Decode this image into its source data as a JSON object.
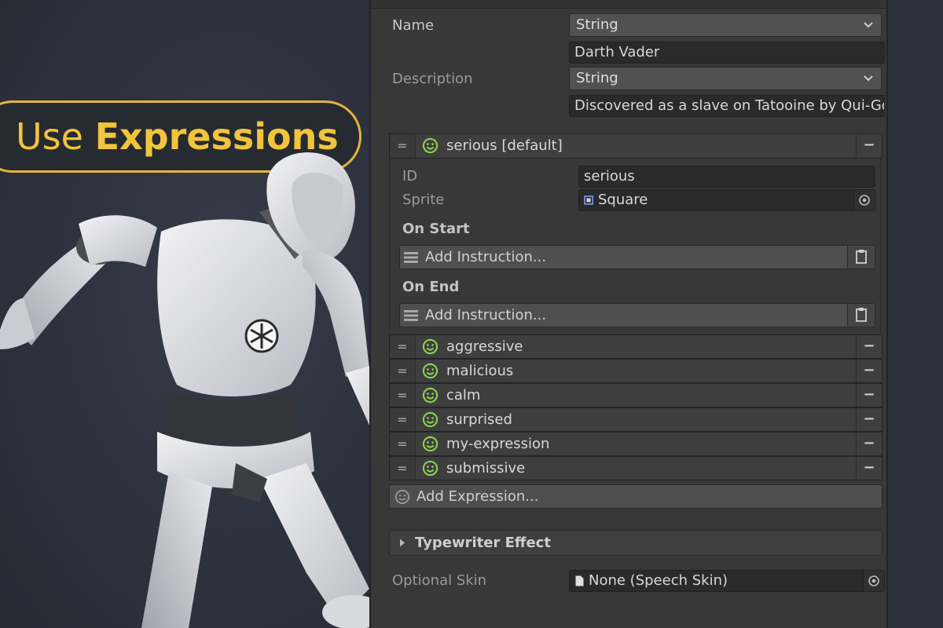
{
  "promo": {
    "title_plain": "Use",
    "title_bold": "Expressions",
    "accent_color": "#f1c43c"
  },
  "inspector": {
    "name": {
      "label": "Name",
      "type_value": "String",
      "text_value": "Darth Vader"
    },
    "description": {
      "label": "Description",
      "type_value": "String",
      "text_value": "Discovered as a slave on Tatooine by Qui-Gon"
    },
    "expanded_expression": {
      "name": "serious [default]",
      "id_label": "ID",
      "id_value": "serious",
      "sprite_label": "Sprite",
      "sprite_value": "Square",
      "on_start_label": "On Start",
      "on_start_button": "Add Instruction...",
      "on_end_label": "On End",
      "on_end_button": "Add Instruction..."
    },
    "expressions": [
      {
        "name": "aggressive"
      },
      {
        "name": "malicious"
      },
      {
        "name": "calm"
      },
      {
        "name": "surprised"
      },
      {
        "name": "my-expression"
      },
      {
        "name": "submissive"
      }
    ],
    "grip_glyph": "=",
    "remove_glyph": "−",
    "add_expression_label": "Add Expression...",
    "typewriter_label": "Typewriter Effect",
    "optional_skin": {
      "label": "Optional Skin",
      "value": "None (Speech Skin)"
    },
    "face_icon_color": "#8fd14f"
  }
}
